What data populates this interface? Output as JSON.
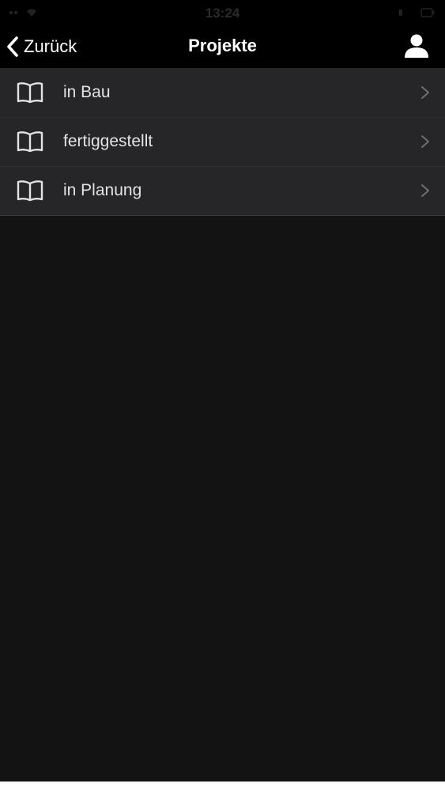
{
  "status_bar": {
    "time": "13:24",
    "signal_icon": "signal-wifi-icon",
    "battery_icon": "battery-icon"
  },
  "nav": {
    "back_label": "Zurück",
    "back_icon": "chevron-left-icon",
    "title": "Projekte",
    "profile_icon": "user-profile-icon"
  },
  "list": {
    "items": [
      {
        "label": "in Bau",
        "icon": "open-book-icon",
        "accessory": "chevron-right-icon"
      },
      {
        "label": "fertiggestellt",
        "icon": "open-book-icon",
        "accessory": "chevron-right-icon"
      },
      {
        "label": "in Planung",
        "icon": "open-book-icon",
        "accessory": "chevron-right-icon"
      }
    ]
  },
  "colors": {
    "background": "#141314",
    "bar_background": "#000000",
    "list_background": "#262527",
    "text": "#e3e3e3",
    "title": "#ffffff",
    "chevron": "#6f6e70"
  }
}
